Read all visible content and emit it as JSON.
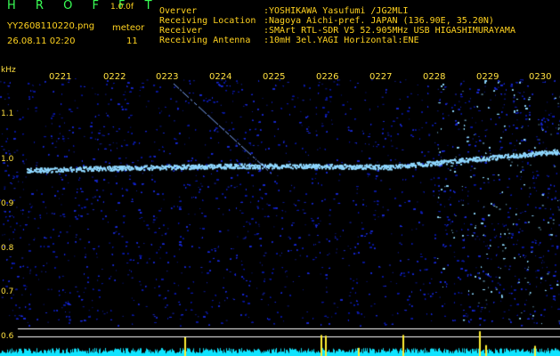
{
  "header": {
    "brand": "H R O F F T",
    "version": "1.0.0f",
    "filename": "YY2608110220.png",
    "mode": "meteor",
    "timestamp": "26.08.11 02:20",
    "count": "11",
    "meta": [
      {
        "label": "Overver",
        "value": ":YOSHIKAWA Yasufumi /JG2MLI"
      },
      {
        "label": "Receiving Location",
        "value": ":Nagoya Aichi-pref. JAPAN (136.90E, 35.20N)"
      },
      {
        "label": "Receiver",
        "value": ":SMArt RTL-SDR V5 52.905MHz USB HIGASHIMURAYAMA"
      },
      {
        "label": "Receiving Antenna",
        "value": ":10mH 3el.YAGI Horizontal:ENE"
      }
    ]
  },
  "axes": {
    "ylabel": "kHz",
    "yticks": [
      "1.1",
      "1.0",
      "0.9",
      "0.8",
      "0.7",
      "0.6"
    ],
    "xticks": [
      "0221",
      "0222",
      "0223",
      "0224",
      "0225",
      "0226",
      "0227",
      "0228",
      "0229",
      "0230"
    ]
  },
  "colors": {
    "background": "#000000",
    "noise": "#1a2ad0",
    "signal": "#8fd8ff",
    "trace": "#ffffff",
    "power": "#10e4ff",
    "spike": "#ffee33",
    "label": "#ffe040"
  }
}
